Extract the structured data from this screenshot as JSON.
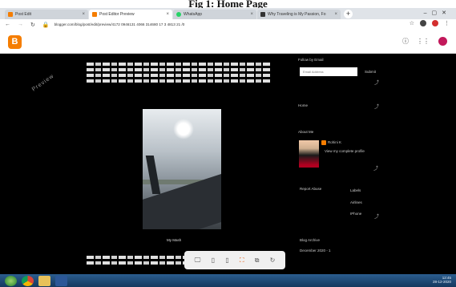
{
  "figure_caption": "Fig 1: Home Page",
  "tabs": [
    {
      "label": "Post Edit",
      "color": "#f57d00"
    },
    {
      "label": "Post Editor Preview",
      "color": "#f57d00"
    },
    {
      "label": "WhatsApp",
      "color": "#25d366"
    },
    {
      "label": "Why Traveling is My Passion, Fo",
      "color": "#333333"
    }
  ],
  "address": {
    "url": "blogger.com/blog/post/edit/preview/4172 0946131 4066 314680 17 3 4813 21 /0"
  },
  "sidebar": {
    "follow_by_email": "Follow by Email",
    "email_placeholder": "Email Address",
    "submit": "Submit",
    "home": "Home",
    "about_me": "About Me",
    "profile_name": "Rohini K",
    "view_profile": "View my complete profile",
    "report_abuse": "Report Abuse",
    "labels_heading": "Labels",
    "label_1": "Airlines",
    "label_2": "IPhone",
    "blog_archive": "Blog Archive",
    "archive_item": "December 2020 - 1"
  },
  "post": {
    "watermark": "Preview",
    "photo_caption": "My Mash"
  },
  "tray": {
    "time": "12:45",
    "date": "28-12-2020"
  }
}
